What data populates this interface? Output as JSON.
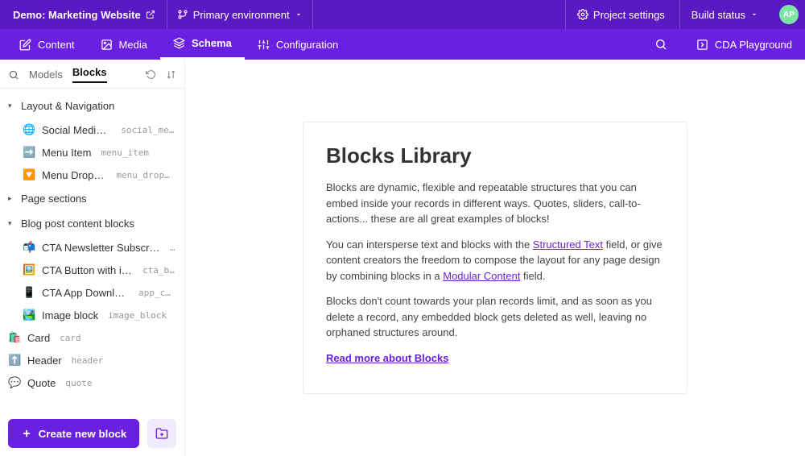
{
  "header": {
    "project_title": "Demo: Marketing Website",
    "environment_label": "Primary environment",
    "project_settings_label": "Project settings",
    "build_status_label": "Build status",
    "avatar_initials": "AP"
  },
  "nav": {
    "items": [
      {
        "label": "Content"
      },
      {
        "label": "Media"
      },
      {
        "label": "Schema",
        "active": true
      },
      {
        "label": "Configuration"
      }
    ],
    "cda_playground_label": "CDA Playground"
  },
  "sidebar": {
    "tabs": {
      "models": "Models",
      "blocks": "Blocks"
    },
    "groups": [
      {
        "label": "Layout & Navigation",
        "expanded": true,
        "items": [
          {
            "icon": "🌐",
            "label": "Social Media Icon",
            "api": "social_medi…"
          },
          {
            "icon": "➡️",
            "label": "Menu Item",
            "api": "menu_item"
          },
          {
            "icon": "🔽",
            "label": "Menu Dropdown",
            "api": "menu_dropdown"
          }
        ]
      },
      {
        "label": "Page sections",
        "expanded": false,
        "items": []
      },
      {
        "label": "Blog post content blocks",
        "expanded": true,
        "items": [
          {
            "icon": "📬",
            "label": "CTA Newsletter Subscription",
            "api": "…"
          },
          {
            "icon": "🖼️",
            "label": "CTA Button with image",
            "api": "cta_bu…"
          },
          {
            "icon": "📱",
            "label": "CTA App Download",
            "api": "app_cta"
          },
          {
            "icon": "🏞️",
            "label": "Image block",
            "api": "image_block"
          }
        ]
      }
    ],
    "top_level": [
      {
        "icon": "🛍️",
        "label": "Card",
        "api": "card"
      },
      {
        "icon": "⬆️",
        "label": "Header",
        "api": "header"
      },
      {
        "icon": "💬",
        "label": "Quote",
        "api": "quote"
      }
    ],
    "create_button": "Create new block"
  },
  "content": {
    "title": "Blocks Library",
    "p1": "Blocks are dynamic, flexible and repeatable structures that you can embed inside your records in different ways. Quotes, sliders, call-to-actions... these are all great examples of blocks!",
    "p2a": "You can intersperse text and blocks with the ",
    "link1": "Structured Text",
    "p2b": " field, or give content creators the freedom to compose the layout for any page design by combining blocks in a ",
    "link2": "Modular Content",
    "p2c": " field.",
    "p3": "Blocks don't count towards your plan records limit, and as soon as you delete a record, any embedded block gets deleted as well, leaving no orphaned structures around.",
    "read_more": "Read more about Blocks"
  }
}
